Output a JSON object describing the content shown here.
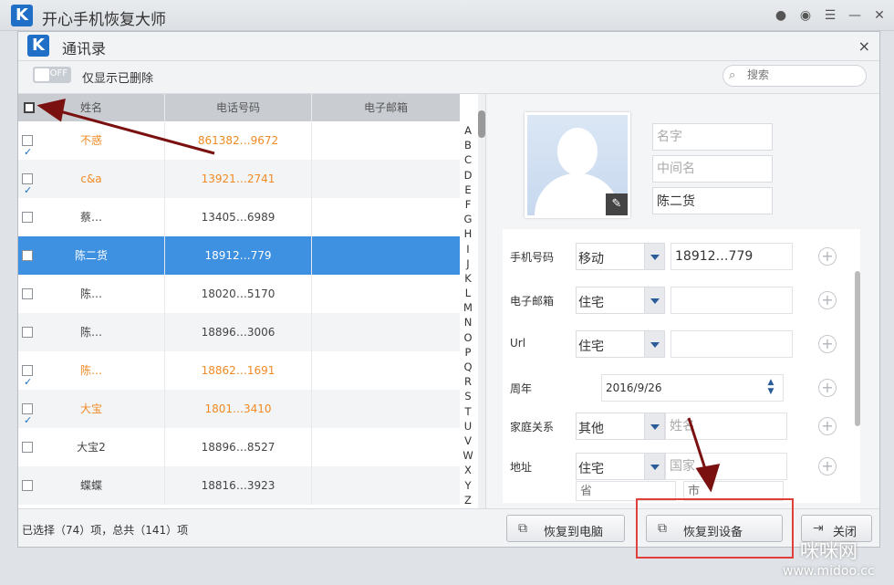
{
  "app": {
    "title": "开心手机恢复大师",
    "logo_letter": "K"
  },
  "dialog": {
    "title": "通讯录",
    "logo_letter": "K",
    "close_symbol": "×"
  },
  "toolbar": {
    "toggle_text": "OFF",
    "toggle_label": "仅显示已删除",
    "search_placeholder": "搜索"
  },
  "table": {
    "columns": [
      "姓名",
      "电话号码",
      "电子邮箱"
    ],
    "rows": [
      {
        "name": "不惑",
        "phone": "861382…9672",
        "checked": true,
        "color": "orange",
        "selected": false
      },
      {
        "name": "c&a",
        "phone": "13921…2741",
        "checked": true,
        "color": "orange",
        "selected": false
      },
      {
        "name": "蔡…",
        "phone": "13405…6989",
        "checked": false,
        "color": "normal",
        "selected": false
      },
      {
        "name": "陈二货",
        "phone": "18912…779",
        "checked": false,
        "color": "white",
        "selected": true
      },
      {
        "name": "陈…",
        "phone": "18020…5170",
        "checked": false,
        "color": "normal",
        "selected": false
      },
      {
        "name": "陈…",
        "phone": "18896…3006",
        "checked": false,
        "color": "normal",
        "selected": false
      },
      {
        "name": "陈…",
        "phone": "18862…1691",
        "checked": true,
        "color": "orange",
        "selected": false
      },
      {
        "name": "大宝",
        "phone": "1801…3410",
        "checked": true,
        "color": "orange",
        "selected": false
      },
      {
        "name": "大宝2",
        "phone": "18896…8527",
        "checked": false,
        "color": "normal",
        "selected": false
      },
      {
        "name": "蝶蝶",
        "phone": "18816…3923",
        "checked": false,
        "color": "normal",
        "selected": false
      }
    ],
    "alphabet": [
      "A",
      "B",
      "C",
      "D",
      "E",
      "F",
      "G",
      "H",
      "I",
      "J",
      "K",
      "L",
      "M",
      "N",
      "O",
      "P",
      "Q",
      "R",
      "S",
      "T",
      "U",
      "V",
      "W",
      "X",
      "Y",
      "Z"
    ]
  },
  "detail": {
    "first_name_placeholder": "名字",
    "middle_name_placeholder": "中间名",
    "last_name_value": "陈二货",
    "fields": {
      "phone": {
        "label": "手机号码",
        "type": "移动",
        "value": "18912…779"
      },
      "email": {
        "label": "电子邮箱",
        "type": "住宅",
        "value": ""
      },
      "url": {
        "label": "Url",
        "type": "住宅",
        "value": ""
      },
      "anniversary": {
        "label": "周年",
        "value": "2016/9/26"
      },
      "relation": {
        "label": "家庭关系",
        "type": "其他",
        "placeholder": "姓名"
      },
      "address": {
        "label": "地址",
        "type": "住宅",
        "country_placeholder": "国家",
        "province_placeholder": "省",
        "city_placeholder": "市"
      }
    }
  },
  "footer": {
    "status": "已选择（74）项，总共（141）项",
    "restore_pc": "恢复到电脑",
    "restore_device": "恢复到设备",
    "close": "关闭"
  },
  "watermark": {
    "title": "咪咪网",
    "url": "www.midoo.cc"
  },
  "colors": {
    "accent": "#3d91e0",
    "orange": "#f08a24",
    "highlight": "#e0403a",
    "arrow": "#7a1010"
  }
}
